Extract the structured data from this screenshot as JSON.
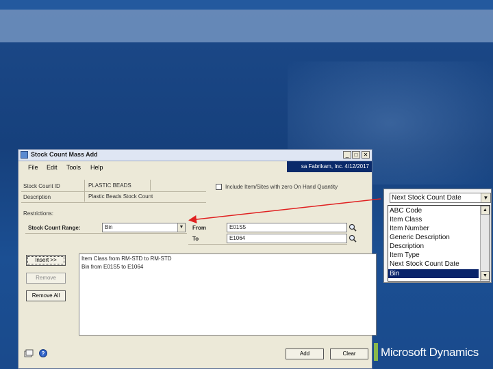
{
  "window": {
    "title": "Stock Count Mass Add",
    "buttons": {
      "minimize": "_",
      "maximize": "□",
      "close": "✕"
    }
  },
  "menu": {
    "items": [
      "File",
      "Edit",
      "Tools",
      "Help"
    ]
  },
  "company": {
    "label": "sa  Fabrikam, Inc.  4/12/2017"
  },
  "form": {
    "stock_count_id_label": "Stock Count ID",
    "stock_count_id_value": "PLASTIC BEADS",
    "description_label": "Description",
    "description_value": "Plastic Beads Stock Count",
    "include_label": "Include Item/Sites with zero On Hand Quantity",
    "restrictions_label": "Restrictions:",
    "range_label": "Stock Count Range:",
    "range_value": "Bin",
    "from_label": "From",
    "from_value": "E01S5",
    "to_label": "To",
    "to_value": "E1064"
  },
  "buttons": {
    "insert": "Insert >>",
    "remove": "Remove",
    "remove_all": "Remove All",
    "add": "Add",
    "clear": "Clear"
  },
  "restriction_list": [
    "Item Class from RM-STD to RM-STD",
    "Bin from E01S5 to E1064"
  ],
  "dropdown": {
    "current": "Next Stock Count Date",
    "options": [
      "ABC Code",
      "Item Class",
      "Item Number",
      "Generic Description",
      "Description",
      "Item Type",
      "Next Stock Count Date",
      "Bin"
    ],
    "selected": "Bin"
  },
  "logo": {
    "text": "Microsoft Dynamics"
  },
  "colors": {
    "accent": "#0a246a",
    "arrow": "#e02020",
    "background": "#1c4a8a"
  }
}
